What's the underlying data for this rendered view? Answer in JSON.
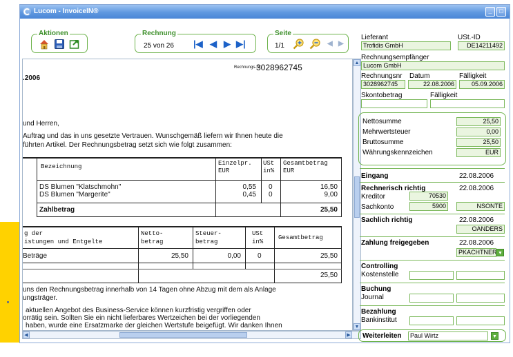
{
  "window": {
    "title": "Lucom - InvoiceIN®"
  },
  "toolbar": {
    "aktionen_label": "Aktionen",
    "rechnung_label": "Rechnung",
    "rechnung_counter": "25 von 26",
    "seite_label": "Seite",
    "seite_counter": "1/1"
  },
  "document": {
    "rechnungsnr_caption": "Rechnungs-Nr.",
    "rechnungsnr_value": "3028962745",
    "date_fragment": ".2006",
    "salutation": "und Herren,",
    "intro_line1": "Auftrag und das in uns gesetzte Vertrauen. Wunschgemäß liefern wir Ihnen heute die",
    "intro_line2": "führten Artikel. Der Rechnungsbetrag setzt sich wie folgt zusammen:",
    "table1": {
      "headers": [
        "Bezeichnung",
        "Einzelpr.",
        "EUR",
        "USt",
        "in%",
        "Gesamtbetrag",
        "EUR"
      ],
      "rows": [
        {
          "name": "DS Blumen \"Klatschmohn\"",
          "price": "0,55",
          "ust": "0",
          "total": "16,50"
        },
        {
          "name": "DS Blumen \"Margerite\"",
          "price": "0,45",
          "ust": "0",
          "total": "9,00"
        }
      ],
      "sum_label": "Zahlbetrag",
      "sum_value": "25,50"
    },
    "table2": {
      "headers": [
        "g der",
        "istungen und Entgelte",
        "Netto-",
        "betrag",
        "Steuer-",
        "betrag",
        "USt",
        "in%",
        "Gesamtbetrag"
      ],
      "row_label": "Beträge",
      "row_netto": "25,50",
      "row_steuer": "0,00",
      "row_ust": "0",
      "row_total": "25,50",
      "total_value": "25,50"
    },
    "footer_line1": "uns den Rechnungsbetrag innerhalb von 14 Tagen ohne Abzug mit dem als Anlage",
    "footer_line2": "ungsträger.",
    "footer_line3": "aktuellen Angebot des Business-Service können kurzfristig vergriffen oder",
    "footer_line4": "orrätig sein. Sollten Sie ein nicht lieferbares Wertzeichen bei der vorliegenden",
    "footer_line5": "haben, wurde eine Ersatzmarke der gleichen Wertstufe beigefügt. Wir danken Ihnen"
  },
  "panel": {
    "lieferant_label": "Lieferant",
    "lieferant_value": "Trofidis GmbH",
    "ustid_label": "USt.-ID",
    "ustid_value": "DE14211492",
    "empfaenger_label": "Rechnungsempfänger",
    "empfaenger_value": "Lucom GmbH",
    "rechnungsnr_label": "Rechnungsnr",
    "rechnungsnr_value": "3028962745",
    "datum_label": "Datum",
    "datum_value": "22.08.2006",
    "faelligkeit_label": "Fälligkeit",
    "faelligkeit_value": "05.09.2006",
    "skonto_label": "Skontobetrag",
    "skonto_faelligkeit_label": "Fälligkeit",
    "netto_label": "Nettosumme",
    "netto_value": "25,50",
    "mwst_label": "Mehrwertsteuer",
    "mwst_value": "0,00",
    "brutto_label": "Bruttosumme",
    "brutto_value": "25,50",
    "waehrung_label": "Währungskennzeichen",
    "waehrung_value": "EUR",
    "eingang_label": "Eingang",
    "eingang_date": "22.08.2006",
    "rechnerisch_label": "Rechnerisch richtig",
    "rechnerisch_date": "22.08.2006",
    "kreditor_label": "Kreditor",
    "kreditor_value": "70530",
    "sachkonto_label": "Sachkonto",
    "sachkonto_value": "5900",
    "sachkonto_user": "NSONTE",
    "sachlich_label": "Sachlich richtig",
    "sachlich_date": "22.08.2006",
    "sachlich_user": "OANDERS",
    "zahlung_label": "Zahlung freigegeben",
    "zahlung_date": "22.08.2006",
    "zahlung_user": "PKACHTNER",
    "controlling_label": "Controlling",
    "kostenstelle_label": "Kostenstelle",
    "buchung_label": "Buchung",
    "journal_label": "Journal",
    "bezahlung_label": "Bezahlung",
    "bankinstitut_label": "Bankinstitut",
    "weiterleiten_label": "Weiterleiten",
    "weiterleiten_value": "Paul Wirtz"
  },
  "colors": {
    "accent_green": "#6cb24a",
    "title_blue": "#5f98e0",
    "field_green": "#eaf5e0",
    "nav_blue": "#1d62c8"
  },
  "icons": [
    "home-icon",
    "save-icon",
    "export-icon",
    "first-icon",
    "prev-icon",
    "next-icon",
    "last-icon",
    "zoom-in-icon",
    "zoom-out-icon",
    "dropdown-icon"
  ]
}
